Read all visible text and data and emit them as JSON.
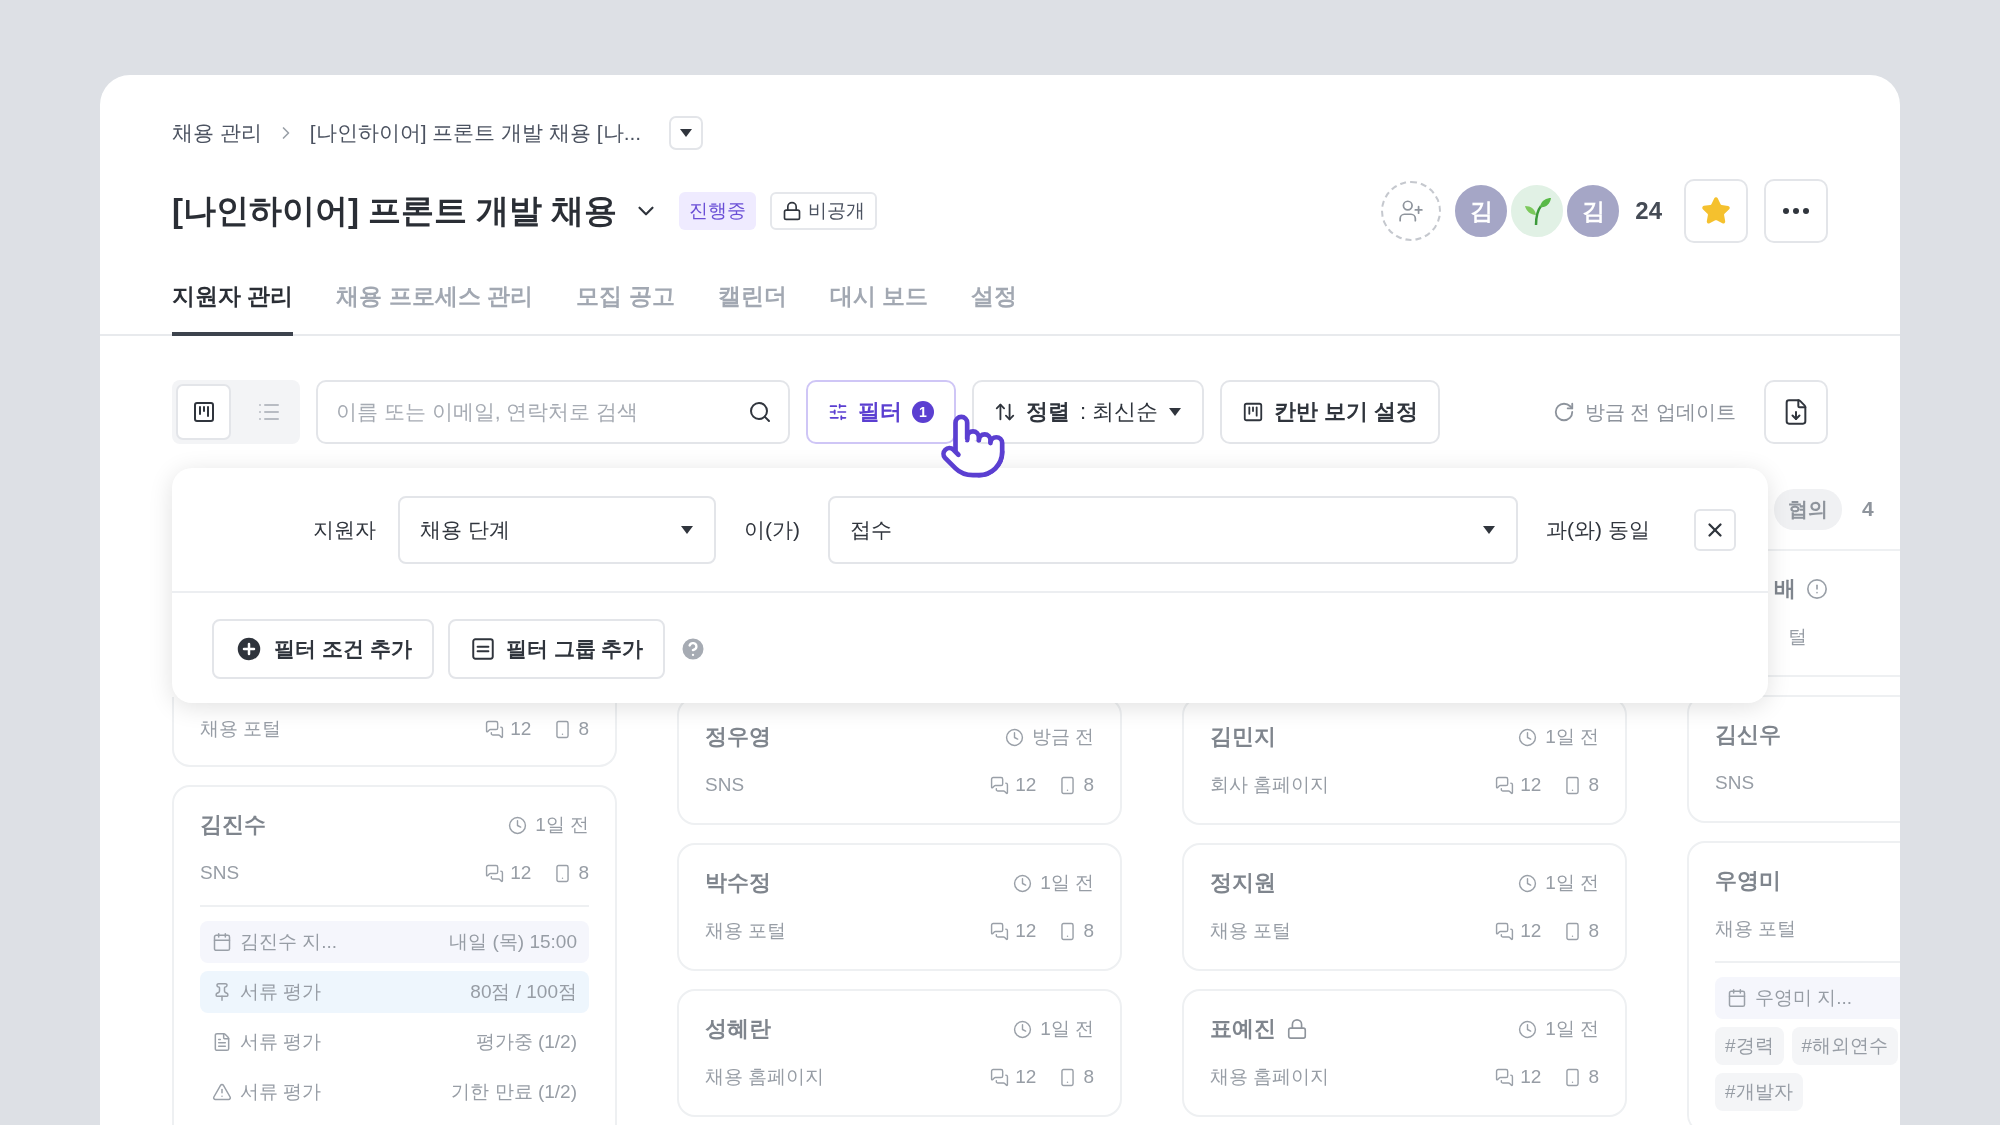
{
  "breadcrumb": {
    "items": [
      "채용 관리",
      "[나인하이어] 프론트 개발 채용 [나..."
    ]
  },
  "header": {
    "title": "[나인하이어] 프론트 개발 채용",
    "status": "진행중",
    "visibility": "비공개",
    "member_avatars": [
      {
        "kind": "initial",
        "label": "김"
      },
      {
        "kind": "sprout"
      },
      {
        "kind": "initial",
        "label": "김"
      }
    ],
    "member_count": "24",
    "starred": true
  },
  "tabs": [
    {
      "label": "지원자 관리",
      "selected": true
    },
    {
      "label": "채용 프로세스 관리",
      "selected": false
    },
    {
      "label": "모집 공고",
      "selected": false
    },
    {
      "label": "캘린더",
      "selected": false
    },
    {
      "label": "대시 보드",
      "selected": false
    },
    {
      "label": "설정",
      "selected": false
    }
  ],
  "toolbar": {
    "view_modes": [
      {
        "kind": "board",
        "selected": true
      },
      {
        "kind": "list",
        "selected": false
      }
    ],
    "search": {
      "placeholder": "이름 또는 이메일, 연락처로 검색"
    },
    "filter": {
      "label": "필터",
      "count": "1",
      "active": true
    },
    "sort": {
      "label": "정렬",
      "separator": ":",
      "value": "최신순"
    },
    "kanban_settings": "칸반 보기 설정",
    "refresh": "방금 전 업데이트"
  },
  "filter_popup": {
    "subject": "지원자",
    "field": "채용 단계",
    "connector": "이(가)",
    "value": "접수",
    "operator": "과(와) 동일",
    "add_condition": "필터 조건 추가",
    "add_group": "필터 그룹 추가"
  },
  "board": {
    "columns": [
      {
        "cards": [
          {
            "kind": "tail",
            "source": "채용 포털",
            "comments": "12",
            "attachments": "8"
          },
          {
            "kind": "card",
            "name": "김진수",
            "locked": false,
            "time": "1일 전",
            "source": "SNS",
            "comments": "12",
            "attachments": "8",
            "details": [
              {
                "kind": "schedule",
                "label": "김진수 지...",
                "value": "내일 (목) 15:00"
              },
              {
                "kind": "score",
                "label": "서류 평가",
                "value": "80점 / 100점"
              },
              {
                "kind": "document",
                "label": "서류 평가",
                "value": "평가중 (1/2)"
              },
              {
                "kind": "warning",
                "label": "서류 평가",
                "value": "기한 만료 (1/2)"
              }
            ]
          }
        ]
      },
      {
        "cards": [
          {
            "kind": "card",
            "name": "정우영",
            "locked": false,
            "time": "방금 전",
            "source": "SNS",
            "comments": "12",
            "attachments": "8"
          },
          {
            "kind": "card",
            "name": "박수정",
            "locked": false,
            "time": "1일 전",
            "source": "채용 포털",
            "comments": "12",
            "attachments": "8"
          },
          {
            "kind": "card",
            "name": "성혜란",
            "locked": false,
            "time": "1일 전",
            "source": "채용 홈페이지",
            "comments": "12",
            "attachments": "8"
          }
        ]
      },
      {
        "cards": [
          {
            "kind": "card",
            "name": "김민지",
            "locked": false,
            "time": "1일 전",
            "source": "회사 홈페이지",
            "comments": "12",
            "attachments": "8"
          },
          {
            "kind": "card",
            "name": "정지원",
            "locked": false,
            "time": "1일 전",
            "source": "채용 포털",
            "comments": "12",
            "attachments": "8"
          },
          {
            "kind": "card",
            "name": "표예진",
            "locked": true,
            "time": "1일 전",
            "source": "채용 홈페이지",
            "comments": "12",
            "attachments": "8"
          }
        ]
      },
      {
        "stage": "협의",
        "count": "4",
        "cards": [
          {
            "kind": "peek",
            "name": "배",
            "source": "털"
          },
          {
            "kind": "card",
            "name": "김신우",
            "locked": false,
            "source": "SNS"
          },
          {
            "kind": "card",
            "name": "우영미",
            "locked": false,
            "source": "채용 포털",
            "details": [
              {
                "kind": "schedule",
                "label": "우영미 지..."
              }
            ],
            "tags": [
              "#경력",
              "#해외연수",
              "#개발자"
            ]
          }
        ]
      }
    ]
  }
}
